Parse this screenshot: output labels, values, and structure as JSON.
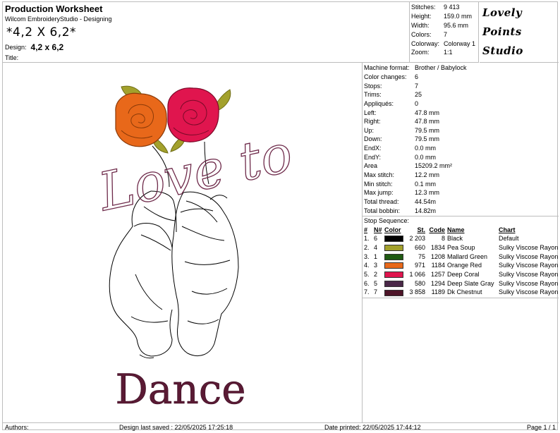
{
  "header": {
    "title": "Production Worksheet",
    "subtitle": "Wilcom EmbroideryStudio - Designing",
    "design_code": "*4,2 X 6,2*",
    "design_label": "Design:",
    "design_value": "4,2 x 6,2",
    "title_label": "Title:"
  },
  "stats": [
    {
      "k": "Stitches:",
      "v": "9 413"
    },
    {
      "k": "Height:",
      "v": "159.0 mm"
    },
    {
      "k": "Width:",
      "v": "95.6 mm"
    },
    {
      "k": "Colors:",
      "v": "7"
    },
    {
      "k": "Colorway:",
      "v": "Colorway 1"
    },
    {
      "k": "Zoom:",
      "v": "1:1"
    }
  ],
  "logo": [
    "Lovely",
    "Points",
    "Studio"
  ],
  "design_text": {
    "top": "Love to",
    "bottom": "Dance"
  },
  "machine": [
    {
      "k": "Machine format:",
      "v": "Brother / Babylock"
    },
    {
      "k": "Color changes:",
      "v": "6"
    },
    {
      "k": "Stops:",
      "v": "7"
    },
    {
      "k": "Trims:",
      "v": "25"
    },
    {
      "k": "Appliqués:",
      "v": "0"
    },
    {
      "k": "Left:",
      "v": "47.8 mm"
    },
    {
      "k": "Right:",
      "v": "47.8 mm"
    },
    {
      "k": "Up:",
      "v": "79.5 mm"
    },
    {
      "k": "Down:",
      "v": "79.5 mm"
    },
    {
      "k": "EndX:",
      "v": "0.0 mm"
    },
    {
      "k": "EndY:",
      "v": "0.0 mm"
    },
    {
      "k": "Area",
      "v": "15209.2 mm²"
    },
    {
      "k": "Max stitch:",
      "v": "12.2 mm"
    },
    {
      "k": "Min stitch:",
      "v": "0.1 mm"
    },
    {
      "k": "Max jump:",
      "v": "12.3 mm"
    },
    {
      "k": "Total thread:",
      "v": "44.54m"
    },
    {
      "k": "Total bobbin:",
      "v": "14.82m"
    }
  ],
  "stop_sequence": {
    "title": "Stop Sequence:",
    "headers": {
      "idx": "#",
      "n": "N#",
      "color": "Color",
      "st": "St.",
      "code": "Code",
      "name": "Name",
      "chart": "Chart"
    },
    "rows": [
      {
        "idx": "1.",
        "n": "6",
        "color": "#000000",
        "st": "2 203",
        "code": "8",
        "name": "Black",
        "chart": "Default"
      },
      {
        "idx": "2.",
        "n": "4",
        "color": "#a3a12c",
        "st": "660",
        "code": "1834",
        "name": "Pea Soup",
        "chart": "Sulky Viscose Rayon"
      },
      {
        "idx": "3.",
        "n": "1",
        "color": "#1f5a12",
        "st": "75",
        "code": "1208",
        "name": "Mallard Green",
        "chart": "Sulky Viscose Rayon"
      },
      {
        "idx": "4.",
        "n": "3",
        "color": "#e8681a",
        "st": "971",
        "code": "1184",
        "name": "Orange Red",
        "chart": "Sulky Viscose Rayon"
      },
      {
        "idx": "5.",
        "n": "2",
        "color": "#e0154e",
        "st": "1 066",
        "code": "1257",
        "name": "Deep Coral",
        "chart": "Sulky Viscose Rayon"
      },
      {
        "idx": "6.",
        "n": "5",
        "color": "#4a2848",
        "st": "580",
        "code": "1294",
        "name": "Deep Slate Gray",
        "chart": "Sulky Viscose Rayon"
      },
      {
        "idx": "7.",
        "n": "7",
        "color": "#4d1428",
        "st": "3 858",
        "code": "1189",
        "name": "Dk Chestnut",
        "chart": "Sulky Viscose Rayon"
      }
    ]
  },
  "footer": {
    "authors": "Authors:",
    "saved": "Design last saved : 22/05/2025 17:25:18",
    "printed": "Date printed: 22/05/2025 17:44:12",
    "page": "Page 1 / 1"
  }
}
